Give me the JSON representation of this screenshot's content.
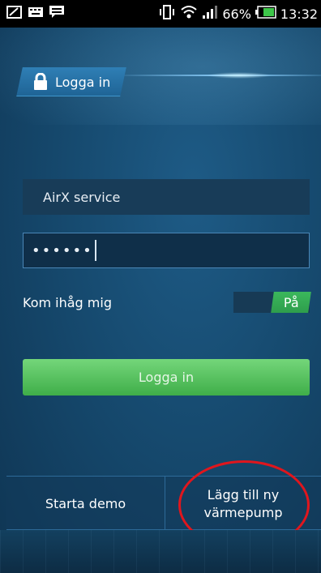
{
  "status_bar": {
    "battery": "66%",
    "time": "13:32",
    "icons": [
      "notification-icon",
      "keyboard-icon",
      "message-icon",
      "vibrate-icon",
      "wifi-icon",
      "signal-icon",
      "battery-icon"
    ]
  },
  "login_tab": {
    "label": "Logga in",
    "icon": "lock-icon"
  },
  "form": {
    "username_value": "AirX service",
    "password_mask": "••••••",
    "remember_label": "Kom ihåg mig",
    "toggle_label": "På",
    "login_button": "Logga in"
  },
  "bottom": {
    "demo_button": "Starta demo",
    "add_button_line1": "Lägg till ny",
    "add_button_line2": "värmepump"
  },
  "colors": {
    "accent_green": "#3fae49",
    "annotation_red": "#e0161d",
    "background_blue": "#164a6f"
  }
}
